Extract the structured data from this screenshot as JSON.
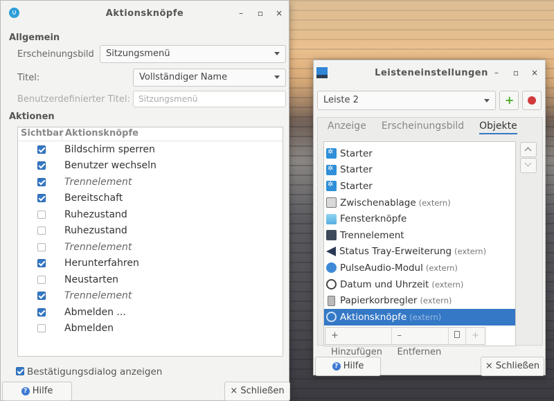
{
  "left_window": {
    "title": "Aktionsknöpfe",
    "minimize": "–",
    "maximize": "▫",
    "close": "×",
    "sections": {
      "general": "Allgemein",
      "actions": "Aktionen"
    },
    "appearance": {
      "label": "Erscheinungsbild",
      "value": "Sitzungsmenü"
    },
    "title_field": {
      "label": "Titel:",
      "value": "Vollständiger Name"
    },
    "custom_title": {
      "label": "Benutzerdefinierter Titel:",
      "placeholder": "Sitzungsmenü"
    },
    "table": {
      "headers": [
        "Sichtbar",
        "Aktionsknöpfe"
      ],
      "rows": [
        {
          "checked": true,
          "label": "Bildschirm sperren",
          "italic": false
        },
        {
          "checked": true,
          "label": "Benutzer wechseln",
          "italic": false
        },
        {
          "checked": true,
          "label": "Trennelement",
          "italic": true
        },
        {
          "checked": true,
          "label": "Bereitschaft",
          "italic": false
        },
        {
          "checked": false,
          "label": "Ruhezustand",
          "italic": false
        },
        {
          "checked": false,
          "label": "Ruhezustand",
          "italic": false
        },
        {
          "checked": false,
          "label": "Trennelement",
          "italic": true
        },
        {
          "checked": true,
          "label": "Herunterfahren",
          "italic": false
        },
        {
          "checked": false,
          "label": "Neustarten",
          "italic": false
        },
        {
          "checked": true,
          "label": "Trennelement",
          "italic": true
        },
        {
          "checked": true,
          "label": "Abmelden ...",
          "italic": false
        },
        {
          "checked": false,
          "label": "Abmelden",
          "italic": false
        }
      ]
    },
    "confirm_checkbox": {
      "label": "Bestätigungsdialog anzeigen",
      "checked": true
    },
    "help_button": "Hilfe",
    "close_button": "Schließen"
  },
  "right_window": {
    "title": "Leisteneinstellungen",
    "minimize": "–",
    "maximize": "▫",
    "close": "×",
    "panel_select": "Leiste 2",
    "tabs": [
      "Anzeige",
      "Erscheinungsbild",
      "Objekte"
    ],
    "active_tab": "Objekte",
    "items": [
      {
        "label": "Starter",
        "ext": "",
        "icon": "starter-icon"
      },
      {
        "label": "Starter",
        "ext": "",
        "icon": "starter-icon"
      },
      {
        "label": "Starter",
        "ext": "",
        "icon": "starter-icon"
      },
      {
        "label": "Zwischenablage",
        "ext": "(extern)",
        "icon": "clipboard-icon"
      },
      {
        "label": "Fensterknöpfe",
        "ext": "",
        "icon": "window-buttons-icon"
      },
      {
        "label": "Trennelement",
        "ext": "",
        "icon": "separator-icon"
      },
      {
        "label": "Status Tray-Erweiterung",
        "ext": "(extern)",
        "icon": "tray-icon"
      },
      {
        "label": "PulseAudio-Modul",
        "ext": "(extern)",
        "icon": "pulseaudio-icon"
      },
      {
        "label": "Datum und Uhrzeit",
        "ext": "(extern)",
        "icon": "clock-icon"
      },
      {
        "label": "Papierkorbregler",
        "ext": "(extern)",
        "icon": "trash-icon"
      },
      {
        "label": "Aktionsknöpfe",
        "ext": "(extern)",
        "icon": "action-buttons-icon",
        "selected": true
      }
    ],
    "add_button": "Hinzufügen",
    "remove_button": "Entfernen",
    "help_button": "Hilfe",
    "close_button": "Schließen"
  }
}
